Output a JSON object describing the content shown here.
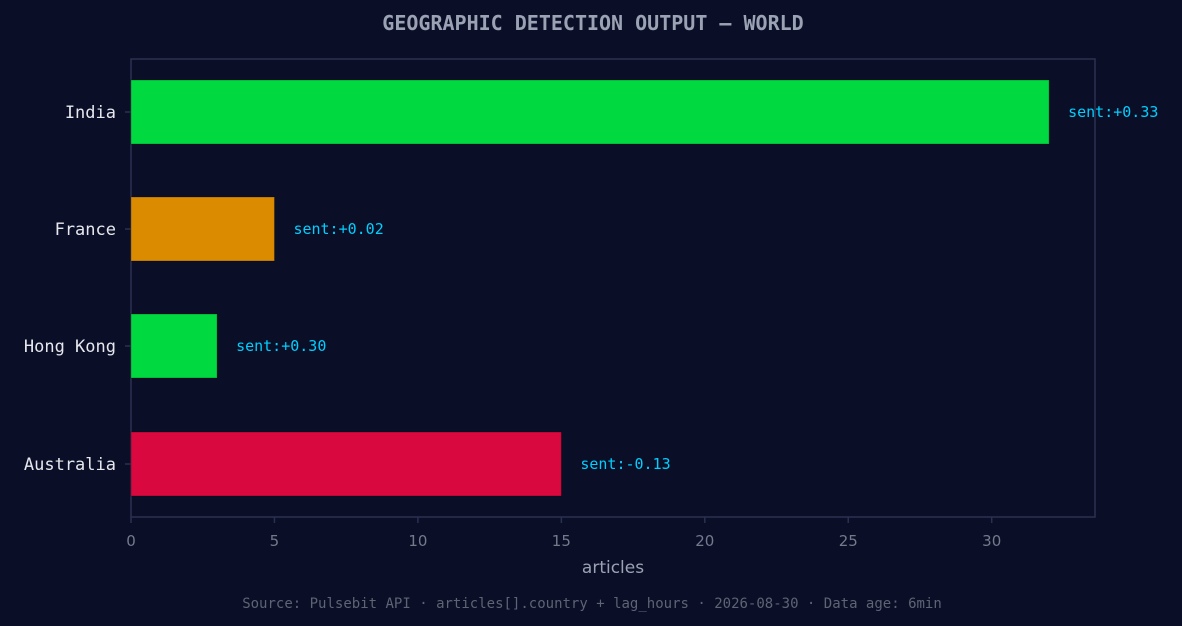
{
  "chart_data": {
    "type": "bar",
    "orientation": "horizontal",
    "title": "GEOGRAPHIC DETECTION OUTPUT — WORLD",
    "xlabel": "articles",
    "ylabel": "",
    "categories": [
      "India",
      "France",
      "Hong Kong",
      "Australia"
    ],
    "values": [
      32,
      5,
      3,
      15
    ],
    "bar_labels": [
      "sent:+0.33",
      "sent:+0.02",
      "sent:+0.30",
      "sent:-0.13"
    ],
    "bar_colors": [
      "#00d93f",
      "#db8b00",
      "#00d93f",
      "#d9083f"
    ],
    "xlim": [
      0,
      33.6
    ],
    "xticks": [
      0,
      5,
      10,
      15,
      20,
      25,
      30
    ],
    "grid": false,
    "legend": "none"
  },
  "footer": {
    "source": "Source: Pulsebit API · articles[].country + lag_hours · 2026-08-30 · Data age: 6min"
  },
  "colors": {
    "background": "#0a0e27",
    "plot_border": "#2a3050",
    "title": "#9aa2b4",
    "category_label": "#e6e8ee",
    "tick_label": "#747a8c",
    "axis_title": "#9aa2b4",
    "bar_label": "#00cfff",
    "source": "#5d6474"
  }
}
